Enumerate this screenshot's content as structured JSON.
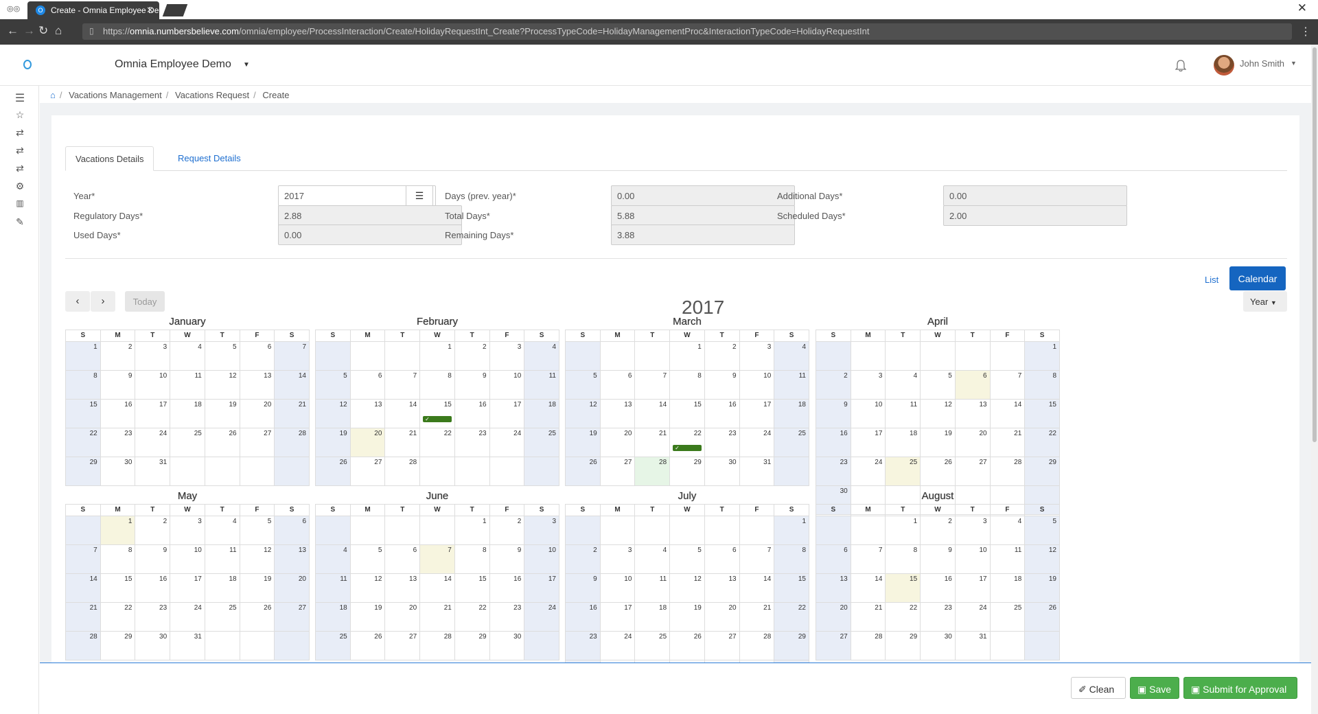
{
  "browser": {
    "tab_title": "Create - Omnia Employee Demo",
    "url_prefix": "https://",
    "url_host": "omnia.numbersbelieve.com",
    "url_path": "/omnia/employee/ProcessInteraction/Create/HolidayRequestInt_Create?ProcessTypeCode=HolidayManagementProc&InteractionTypeCode=HolidayRequestInt"
  },
  "header": {
    "app_title": "Omnia Employee Demo",
    "user_name": "John Smith"
  },
  "breadcrumb": [
    "Vacations Management",
    "Vacations Request",
    "Create"
  ],
  "tabs": [
    "Vacations Details",
    "Request Details"
  ],
  "fields": {
    "year_label": "Year*",
    "year_value": "2017",
    "prev_days_label": "Days (prev. year)*",
    "prev_days_value": "0.00",
    "additional_label": "Additional Days*",
    "additional_value": "0.00",
    "regulatory_label": "Regulatory Days*",
    "regulatory_value": "2.88",
    "total_label": "Total Days*",
    "total_value": "5.88",
    "scheduled_label": "Scheduled Days*",
    "scheduled_value": "2.00",
    "used_label": "Used Days*",
    "used_value": "0.00",
    "remaining_label": "Remaining Days*",
    "remaining_value": "3.88"
  },
  "calendar": {
    "view_list": "List",
    "view_calendar": "Calendar",
    "today": "Today",
    "year_title": "2017",
    "range_select": "Year",
    "weekdays": [
      "S",
      "M",
      "T",
      "W",
      "T",
      "F",
      "S"
    ],
    "months": [
      {
        "name": "January",
        "start": 0,
        "days": 31,
        "highlight": [],
        "green": [],
        "events": []
      },
      {
        "name": "February",
        "start": 3,
        "days": 28,
        "highlight": [
          20
        ],
        "green": [],
        "events": [
          15
        ]
      },
      {
        "name": "March",
        "start": 3,
        "days": 31,
        "highlight": [],
        "green": [
          28
        ],
        "events": [
          22
        ]
      },
      {
        "name": "April",
        "start": 6,
        "days": 30,
        "highlight": [
          6,
          25
        ],
        "green": [
          -2
        ],
        "events": []
      },
      {
        "name": "May",
        "start": 1,
        "days": 31,
        "highlight": [
          1
        ],
        "green": [],
        "events": []
      },
      {
        "name": "June",
        "start": 4,
        "days": 30,
        "highlight": [
          7
        ],
        "green": [],
        "events": []
      },
      {
        "name": "July",
        "start": 6,
        "days": 31,
        "highlight": [],
        "green": [],
        "events": []
      },
      {
        "name": "August",
        "start": 2,
        "days": 31,
        "highlight": [
          15
        ],
        "green": [],
        "events": []
      }
    ]
  },
  "footer": {
    "clean": "Clean",
    "save": "Save",
    "submit": "Submit for Approval"
  }
}
